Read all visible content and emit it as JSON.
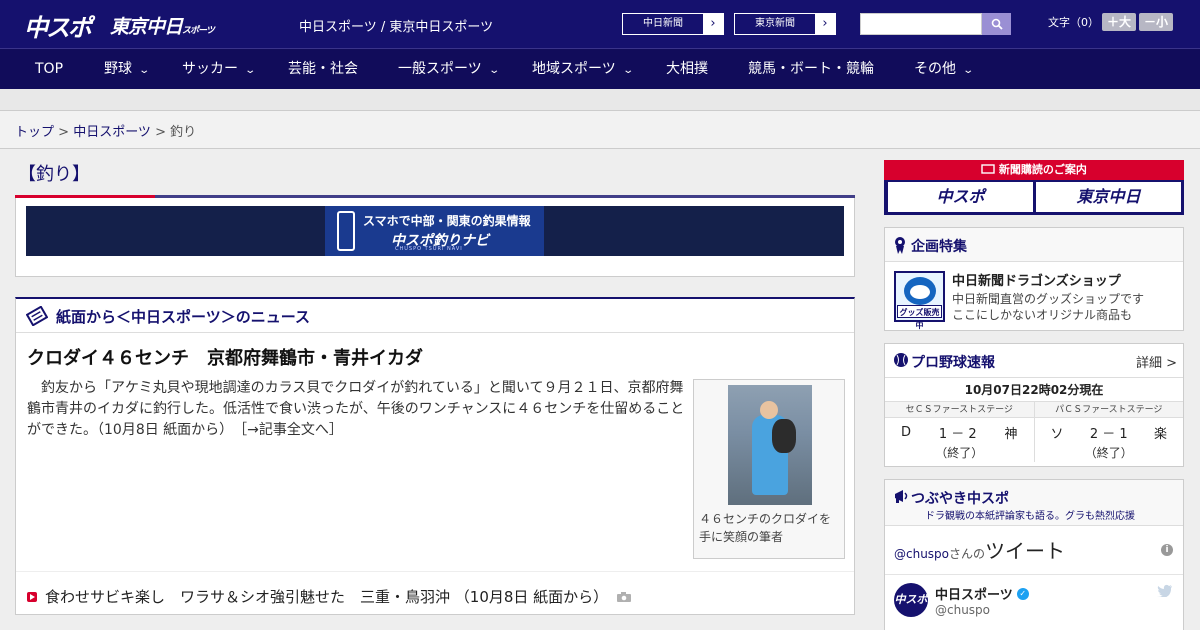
{
  "header": {
    "logo_main": "中スポ",
    "logo_tokyo": "東京中日",
    "logo_tokyo_small": "スポーツ",
    "site_link_1": "中日スポーツ",
    "site_sep": " / ",
    "site_link_2": "東京中日スポーツ",
    "newspaper_1": "中日新聞",
    "newspaper_2": "東京新聞",
    "search_placeholder": "",
    "fontsize_label": "文字（0）",
    "fontsize_up": "＋大",
    "fontsize_down": "－小"
  },
  "nav": {
    "items": [
      {
        "label": "TOP",
        "chevron": ""
      },
      {
        "label": "野球",
        "chevron": "⌄"
      },
      {
        "label": "サッカー",
        "chevron": "⌄"
      },
      {
        "label": "芸能・社会",
        "chevron": ""
      },
      {
        "label": "一般スポーツ",
        "chevron": "⌄"
      },
      {
        "label": "地域スポーツ",
        "chevron": "⌄"
      },
      {
        "label": "大相撲",
        "chevron": ""
      },
      {
        "label": "競馬・ボート・競輪",
        "chevron": ""
      },
      {
        "label": "その他",
        "chevron": "⌄"
      }
    ]
  },
  "breadcrumb": {
    "home": "トップ",
    "sep": " > ",
    "parent": "中日スポーツ",
    "current": "釣り"
  },
  "section": {
    "title": "【釣り】",
    "banner_line1": "スマホで中部・関東の釣果情報",
    "banner_line2": "中スポ釣りナビ",
    "banner_line3": "CHUSPO TSURI NAVI"
  },
  "news": {
    "heading": "紙面から＜中日スポーツ＞のニュース",
    "article_title": "クロダイ４６センチ　京都府舞鶴市・青井イカダ",
    "article_body": "　釣友から「アケミ丸貝や現地調達のカラス貝でクロダイが釣れている」と聞いて９月２１日、京都府舞鶴市青井のイカダに釣行した。低活性で食い渋ったが、午後のワンチャンスに４６センチを仕留めることができた。（10月8日 紙面から）",
    "article_link": "［→記事全文へ］",
    "photo_caption": "４６センチのクロダイを手に笑顔の筆者",
    "sub_item": "食わせサビキ楽し　ワラサ＆シオ強引魅せた　三重・鳥羽沖 （10月8日 紙面から）"
  },
  "sidebar": {
    "subscribe_title": "新聞購読のご案内",
    "subscribe_btn_1": "中スポ",
    "subscribe_btn_2": "東京中日",
    "feature_heading": "企画特集",
    "feature_badge": "グッズ販売中",
    "feature_title": "中日新聞ドラゴンズショップ",
    "feature_desc_1": "中日新聞直営のグッズショップです",
    "feature_desc_2": "ここにしかないオリジナル商品も",
    "score_heading": "プロ野球速報",
    "score_more": "詳細 >",
    "score_time": "10月07日22時02分現在",
    "games": [
      {
        "stage": "セＣＳファーストステージ",
        "home": "D",
        "score": "1 － 2",
        "away": "神",
        "status": "（終了）"
      },
      {
        "stage": "パＣＳファーストステージ",
        "home": "ソ",
        "score": "2 － 1",
        "away": "楽",
        "status": "（終了）"
      }
    ],
    "tweet_heading": "つぶやき中スポ",
    "tweet_sub": "ドラ観戦の本紙評論家も語る。グラも熱烈応援",
    "tweet_handle_prefix": "@chuspo",
    "tweet_handle_suffix": "さんの",
    "tweet_big": "ツイート",
    "tweet_info": "i",
    "tweet_avatar": "中スポ",
    "tweet_name": "中日スポーツ",
    "tweet_verified": "✓",
    "tweet_handle": "@chuspo"
  }
}
